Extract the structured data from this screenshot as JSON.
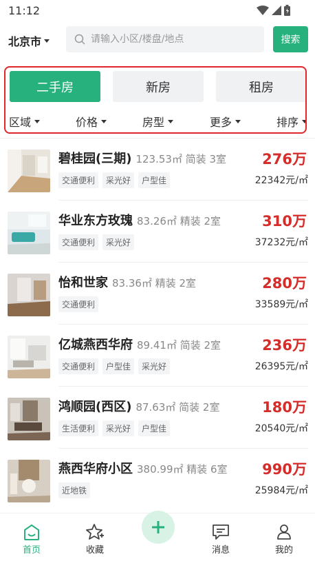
{
  "status_bar": {
    "time": "11:12"
  },
  "header": {
    "city": "北京市",
    "search_placeholder": "请输入小区/楼盘/地点",
    "search_button": "搜索"
  },
  "tabs": [
    {
      "label": "二手房",
      "active": true
    },
    {
      "label": "新房",
      "active": false
    },
    {
      "label": "租房",
      "active": false
    }
  ],
  "filters": [
    "区域",
    "价格",
    "房型",
    "更多",
    "排序"
  ],
  "listings": [
    {
      "name": "碧桂园(三期)",
      "specs": "123.53㎡ 简装 3室",
      "tags": [
        "交通便利",
        "采光好",
        "户型佳"
      ],
      "price": "276万",
      "unit_price": "22342元/㎡"
    },
    {
      "name": "华业东方玫瑰",
      "specs": "83.26㎡ 精装 2室",
      "tags": [
        "交通便利",
        "采光好"
      ],
      "price": "310万",
      "unit_price": "37232元/㎡"
    },
    {
      "name": "怡和世家",
      "specs": "83.36㎡ 精装 2室",
      "tags": [
        "交通便利"
      ],
      "price": "280万",
      "unit_price": "33589元/㎡"
    },
    {
      "name": "亿城燕西华府",
      "specs": "89.41㎡ 简装 2室",
      "tags": [
        "交通便利",
        "户型佳",
        "采光好"
      ],
      "price": "236万",
      "unit_price": "26395元/㎡"
    },
    {
      "name": "鸿顺园(西区)",
      "specs": "87.63㎡ 简装 2室",
      "tags": [
        "生活便利",
        "采光好",
        "户型佳"
      ],
      "price": "180万",
      "unit_price": "20540元/㎡"
    },
    {
      "name": "燕西华府小区",
      "specs": "380.99㎡ 精装 6室",
      "tags": [
        "近地铁"
      ],
      "price": "990万",
      "unit_price": "25984元/㎡"
    }
  ],
  "bottom_nav": [
    {
      "label": "首页",
      "icon": "home-icon",
      "active": true
    },
    {
      "label": "收藏",
      "icon": "star-icon",
      "active": false
    },
    {
      "label": "",
      "icon": "plus-icon",
      "active": false
    },
    {
      "label": "消息",
      "icon": "message-icon",
      "active": false
    },
    {
      "label": "我的",
      "icon": "profile-icon",
      "active": false
    }
  ],
  "colors": {
    "accent": "#27b27d",
    "price": "#d42d2a",
    "highlight": "#e0262b"
  }
}
